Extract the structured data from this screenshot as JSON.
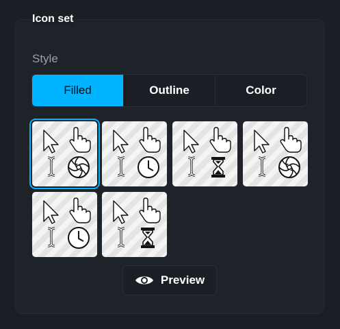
{
  "panel": {
    "title": "Icon set"
  },
  "style": {
    "label": "Style",
    "options": [
      "Filled",
      "Outline",
      "Color"
    ],
    "selected": "Filled"
  },
  "icon_sets": [
    {
      "id": 1,
      "selected": true,
      "icons": [
        "arrow-pointer-icon",
        "hand-pointer-icon",
        "text-ibeam-icon",
        "aperture-spinner-icon"
      ]
    },
    {
      "id": 2,
      "selected": false,
      "icons": [
        "arrow-pointer-icon",
        "hand-pointer-icon",
        "text-ibeam-icon",
        "clock-icon"
      ]
    },
    {
      "id": 3,
      "selected": false,
      "icons": [
        "arrow-pointer-icon",
        "hand-pointer-icon",
        "text-ibeam-icon",
        "hourglass-icon"
      ]
    },
    {
      "id": 4,
      "selected": false,
      "icons": [
        "arrow-pointer-icon",
        "hand-pointer-icon",
        "text-ibeam-icon",
        "aperture-spinner-icon"
      ]
    },
    {
      "id": 5,
      "selected": false,
      "icons": [
        "arrow-pointer-icon",
        "hand-pointer-icon",
        "text-ibeam-icon",
        "clock-icon"
      ]
    },
    {
      "id": 6,
      "selected": false,
      "icons": [
        "arrow-pointer-icon",
        "hand-pointer-icon",
        "text-ibeam-icon",
        "hourglass-icon"
      ]
    }
  ],
  "preview": {
    "label": "Preview",
    "icon": "eye-icon"
  },
  "colors": {
    "accent": "#00b4ff",
    "background": "#1b1e24",
    "panel": "#1e2229"
  }
}
